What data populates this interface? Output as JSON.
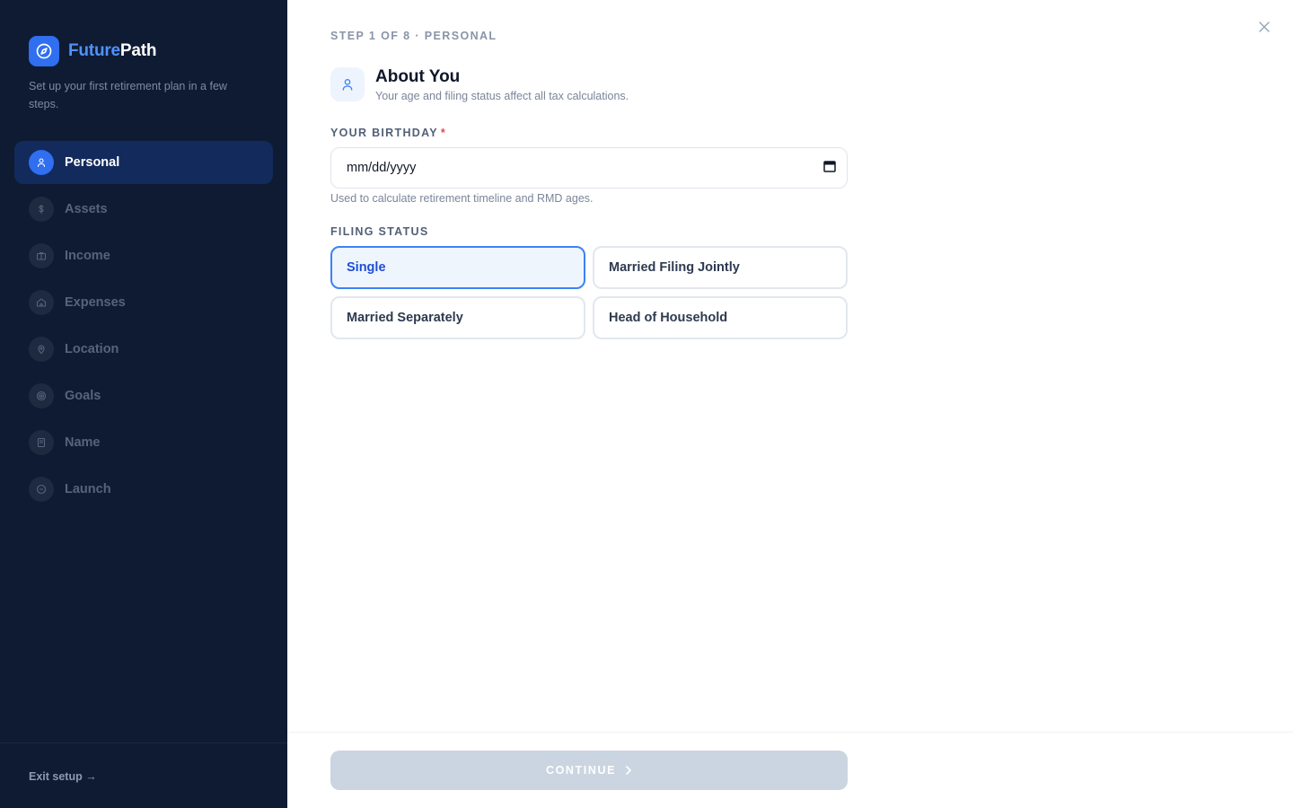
{
  "brand": {
    "name_part1": "Future",
    "name_part2": "Path",
    "tagline": "Set up your first retirement plan in a few steps.",
    "accent_color": "#2f6ff0",
    "logo_icon": "compass-icon"
  },
  "sidebar": {
    "items": [
      {
        "label": "Personal",
        "icon": "user-icon",
        "active": true
      },
      {
        "label": "Assets",
        "icon": "dollar-icon",
        "active": false
      },
      {
        "label": "Income",
        "icon": "briefcase-icon",
        "active": false
      },
      {
        "label": "Expenses",
        "icon": "home-icon",
        "active": false
      },
      {
        "label": "Location",
        "icon": "map-pin-icon",
        "active": false
      },
      {
        "label": "Goals",
        "icon": "target-icon",
        "active": false
      },
      {
        "label": "Name",
        "icon": "document-icon",
        "active": false
      },
      {
        "label": "Launch",
        "icon": "circle-icon",
        "active": false
      }
    ],
    "exit_label": "Exit setup →"
  },
  "main": {
    "step_label": "STEP 1 OF 8 · PERSONAL",
    "section_title": "About You",
    "section_subtitle": "Your age and filing status affect all tax calculations.",
    "birthday": {
      "label": "YOUR BIRTHDAY",
      "required_marker": "*",
      "value": "mm/dd/yyyy",
      "hint": "Used to calculate retirement timeline and RMD ages."
    },
    "filing": {
      "label": "FILING STATUS",
      "options": [
        "Single",
        "Married Filing Jointly",
        "Married Separately",
        "Head of Household"
      ],
      "selected": "Single"
    },
    "continue_label": "CONTINUE"
  }
}
